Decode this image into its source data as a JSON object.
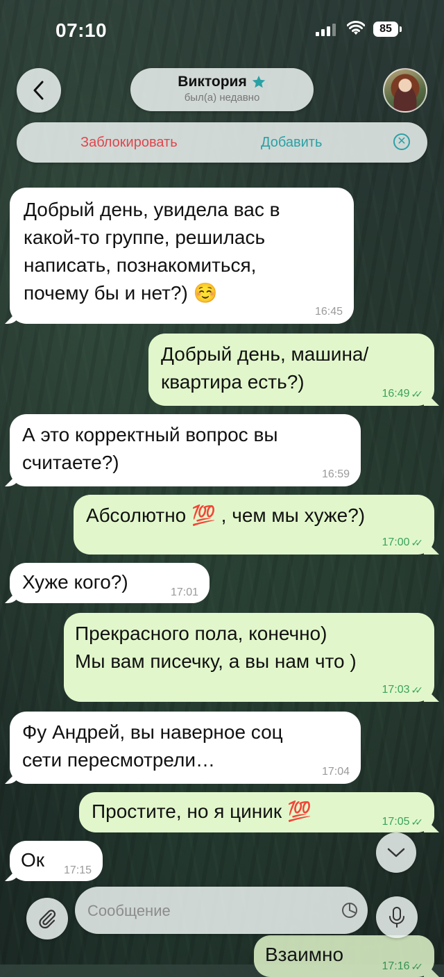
{
  "status_bar": {
    "time": "07:10",
    "battery": "85"
  },
  "header": {
    "contact_name": "Виктория",
    "contact_status": "был(а) недавно"
  },
  "action_bar": {
    "block_label": "Заблокировать",
    "add_label": "Добавить"
  },
  "messages": [
    {
      "dir": "in",
      "text": "Добрый день, увидела вас в\nкакой-то группе, решилась\nнаписать, познакомиться,\nпочему бы и нет?) ☺️",
      "time": "16:45"
    },
    {
      "dir": "out",
      "text": "Добрый день, машина/\nквартира есть?)",
      "time": "16:49"
    },
    {
      "dir": "in",
      "text": "А это корректный вопрос вы\nсчитаете?)",
      "time": "16:59"
    },
    {
      "dir": "out",
      "text": "Абсолютно 💯 , чем мы хуже?)",
      "time": "17:00"
    },
    {
      "dir": "in",
      "text": "Хуже кого?)",
      "time": "17:01"
    },
    {
      "dir": "out",
      "text": "Прекрасного пола, конечно)\nМы вам писечку, а вы нам что )",
      "time": "17:03"
    },
    {
      "dir": "in",
      "text": "Фу Андрей, вы наверное соц\nсети пересмотрели…",
      "time": "17:04"
    },
    {
      "dir": "out",
      "text": "Простите, но я циник 💯",
      "time": "17:05"
    },
    {
      "dir": "in",
      "text": "Ок",
      "time": "17:15"
    },
    {
      "dir": "out",
      "text": "Взаимно",
      "time": "17:16"
    }
  ],
  "composer": {
    "placeholder": "Сообщение"
  },
  "colors": {
    "incoming_bubble": "#ffffff",
    "outgoing_bubble": "#e1f7cb",
    "block_red": "#e0454d",
    "accent_teal": "#2aa1a5",
    "read_tick_green": "#3aa35a"
  },
  "icons": {
    "back": "chevron-left-icon",
    "star": "star-icon",
    "close": "close-circle-icon",
    "scroll_down": "chevron-down-icon",
    "attach": "paperclip-icon",
    "sticker": "sticker-icon",
    "mic": "microphone-icon"
  }
}
